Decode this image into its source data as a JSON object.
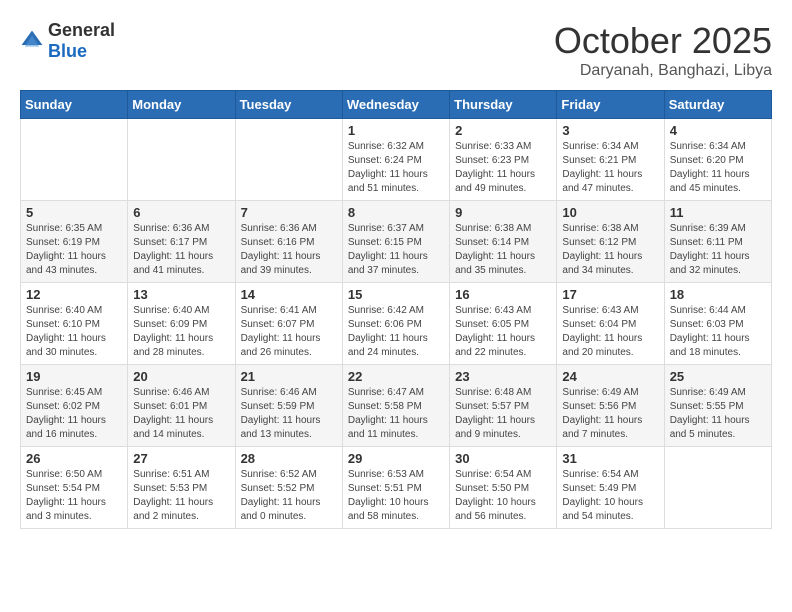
{
  "header": {
    "logo_general": "General",
    "logo_blue": "Blue",
    "month": "October 2025",
    "location": "Daryanah, Banghazi, Libya"
  },
  "days_of_week": [
    "Sunday",
    "Monday",
    "Tuesday",
    "Wednesday",
    "Thursday",
    "Friday",
    "Saturday"
  ],
  "weeks": [
    [
      {
        "day": "",
        "info": ""
      },
      {
        "day": "",
        "info": ""
      },
      {
        "day": "",
        "info": ""
      },
      {
        "day": "1",
        "info": "Sunrise: 6:32 AM\nSunset: 6:24 PM\nDaylight: 11 hours\nand 51 minutes."
      },
      {
        "day": "2",
        "info": "Sunrise: 6:33 AM\nSunset: 6:23 PM\nDaylight: 11 hours\nand 49 minutes."
      },
      {
        "day": "3",
        "info": "Sunrise: 6:34 AM\nSunset: 6:21 PM\nDaylight: 11 hours\nand 47 minutes."
      },
      {
        "day": "4",
        "info": "Sunrise: 6:34 AM\nSunset: 6:20 PM\nDaylight: 11 hours\nand 45 minutes."
      }
    ],
    [
      {
        "day": "5",
        "info": "Sunrise: 6:35 AM\nSunset: 6:19 PM\nDaylight: 11 hours\nand 43 minutes."
      },
      {
        "day": "6",
        "info": "Sunrise: 6:36 AM\nSunset: 6:17 PM\nDaylight: 11 hours\nand 41 minutes."
      },
      {
        "day": "7",
        "info": "Sunrise: 6:36 AM\nSunset: 6:16 PM\nDaylight: 11 hours\nand 39 minutes."
      },
      {
        "day": "8",
        "info": "Sunrise: 6:37 AM\nSunset: 6:15 PM\nDaylight: 11 hours\nand 37 minutes."
      },
      {
        "day": "9",
        "info": "Sunrise: 6:38 AM\nSunset: 6:14 PM\nDaylight: 11 hours\nand 35 minutes."
      },
      {
        "day": "10",
        "info": "Sunrise: 6:38 AM\nSunset: 6:12 PM\nDaylight: 11 hours\nand 34 minutes."
      },
      {
        "day": "11",
        "info": "Sunrise: 6:39 AM\nSunset: 6:11 PM\nDaylight: 11 hours\nand 32 minutes."
      }
    ],
    [
      {
        "day": "12",
        "info": "Sunrise: 6:40 AM\nSunset: 6:10 PM\nDaylight: 11 hours\nand 30 minutes."
      },
      {
        "day": "13",
        "info": "Sunrise: 6:40 AM\nSunset: 6:09 PM\nDaylight: 11 hours\nand 28 minutes."
      },
      {
        "day": "14",
        "info": "Sunrise: 6:41 AM\nSunset: 6:07 PM\nDaylight: 11 hours\nand 26 minutes."
      },
      {
        "day": "15",
        "info": "Sunrise: 6:42 AM\nSunset: 6:06 PM\nDaylight: 11 hours\nand 24 minutes."
      },
      {
        "day": "16",
        "info": "Sunrise: 6:43 AM\nSunset: 6:05 PM\nDaylight: 11 hours\nand 22 minutes."
      },
      {
        "day": "17",
        "info": "Sunrise: 6:43 AM\nSunset: 6:04 PM\nDaylight: 11 hours\nand 20 minutes."
      },
      {
        "day": "18",
        "info": "Sunrise: 6:44 AM\nSunset: 6:03 PM\nDaylight: 11 hours\nand 18 minutes."
      }
    ],
    [
      {
        "day": "19",
        "info": "Sunrise: 6:45 AM\nSunset: 6:02 PM\nDaylight: 11 hours\nand 16 minutes."
      },
      {
        "day": "20",
        "info": "Sunrise: 6:46 AM\nSunset: 6:01 PM\nDaylight: 11 hours\nand 14 minutes."
      },
      {
        "day": "21",
        "info": "Sunrise: 6:46 AM\nSunset: 5:59 PM\nDaylight: 11 hours\nand 13 minutes."
      },
      {
        "day": "22",
        "info": "Sunrise: 6:47 AM\nSunset: 5:58 PM\nDaylight: 11 hours\nand 11 minutes."
      },
      {
        "day": "23",
        "info": "Sunrise: 6:48 AM\nSunset: 5:57 PM\nDaylight: 11 hours\nand 9 minutes."
      },
      {
        "day": "24",
        "info": "Sunrise: 6:49 AM\nSunset: 5:56 PM\nDaylight: 11 hours\nand 7 minutes."
      },
      {
        "day": "25",
        "info": "Sunrise: 6:49 AM\nSunset: 5:55 PM\nDaylight: 11 hours\nand 5 minutes."
      }
    ],
    [
      {
        "day": "26",
        "info": "Sunrise: 6:50 AM\nSunset: 5:54 PM\nDaylight: 11 hours\nand 3 minutes."
      },
      {
        "day": "27",
        "info": "Sunrise: 6:51 AM\nSunset: 5:53 PM\nDaylight: 11 hours\nand 2 minutes."
      },
      {
        "day": "28",
        "info": "Sunrise: 6:52 AM\nSunset: 5:52 PM\nDaylight: 11 hours\nand 0 minutes."
      },
      {
        "day": "29",
        "info": "Sunrise: 6:53 AM\nSunset: 5:51 PM\nDaylight: 10 hours\nand 58 minutes."
      },
      {
        "day": "30",
        "info": "Sunrise: 6:54 AM\nSunset: 5:50 PM\nDaylight: 10 hours\nand 56 minutes."
      },
      {
        "day": "31",
        "info": "Sunrise: 6:54 AM\nSunset: 5:49 PM\nDaylight: 10 hours\nand 54 minutes."
      },
      {
        "day": "",
        "info": ""
      }
    ]
  ]
}
